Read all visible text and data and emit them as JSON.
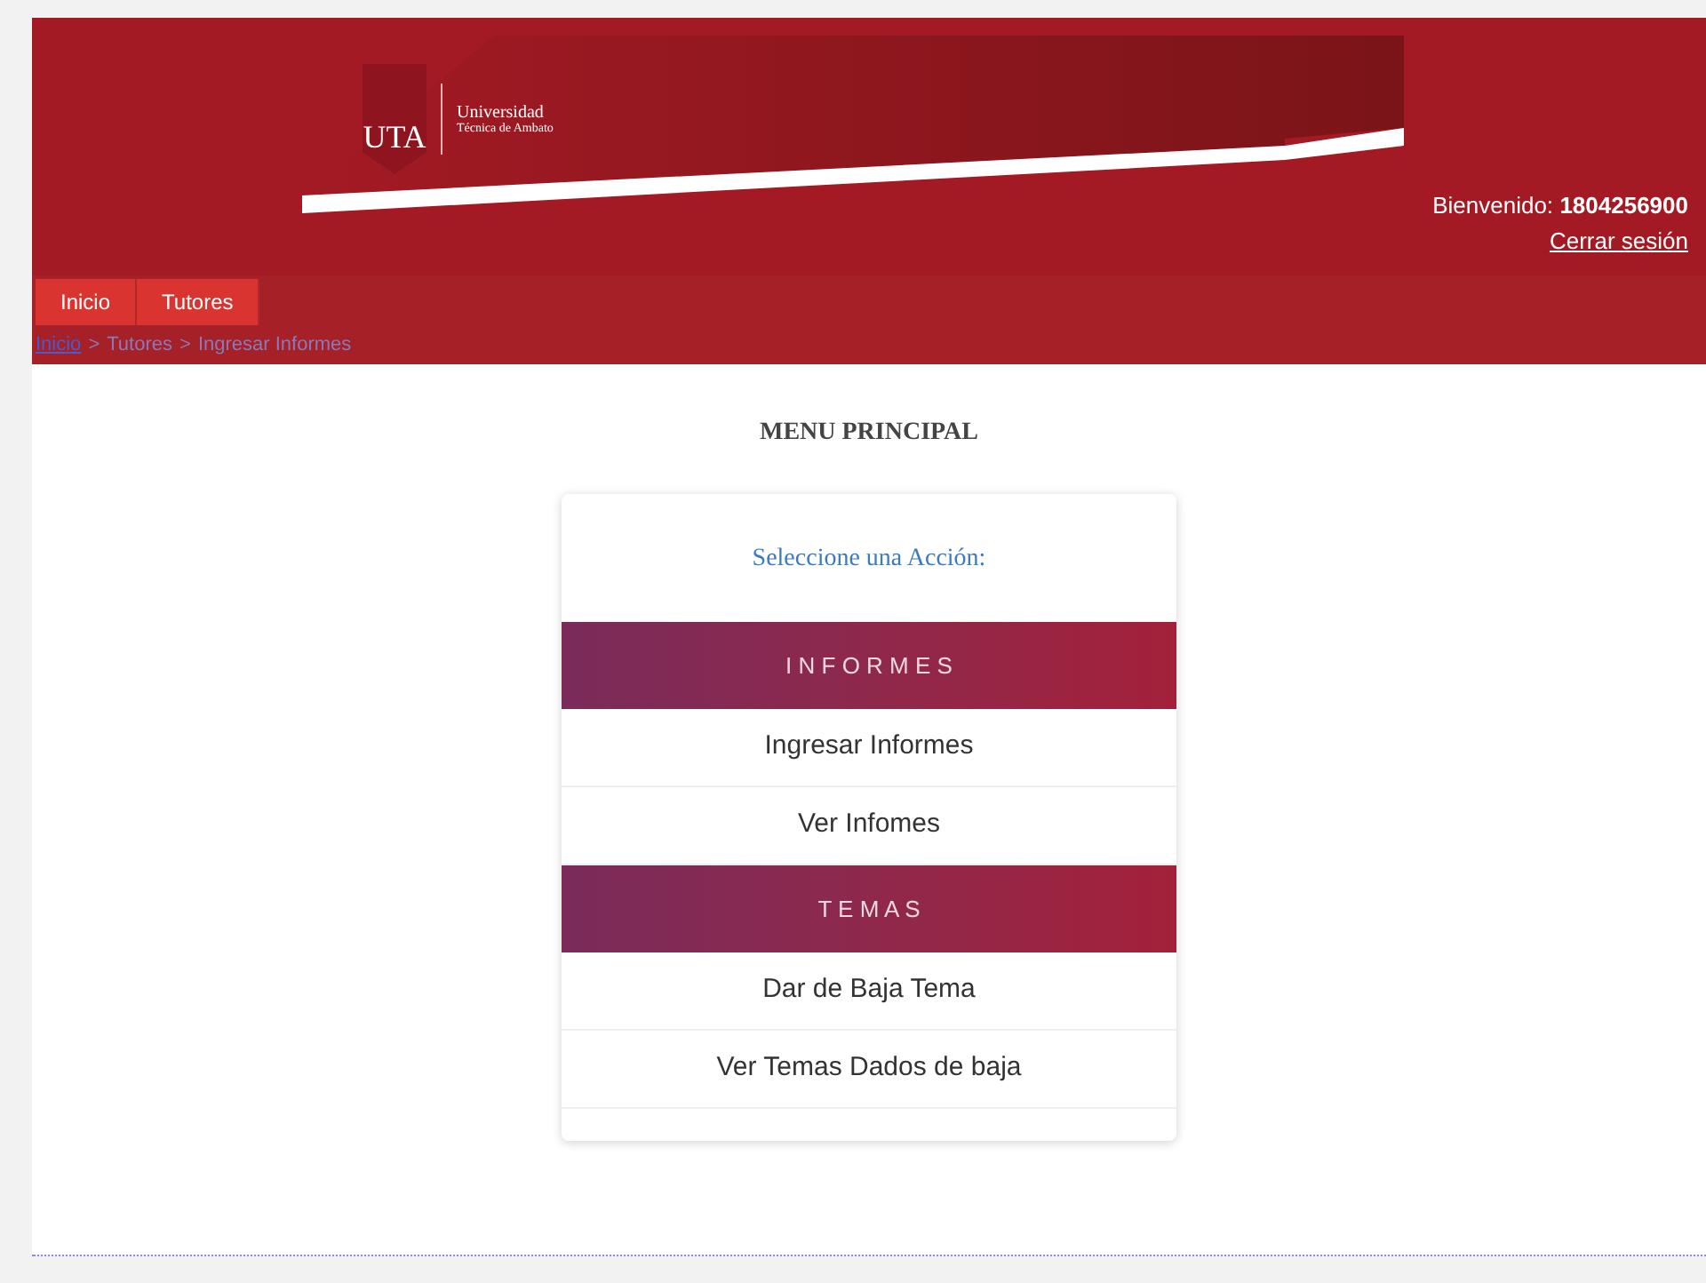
{
  "logo": {
    "mark": "UTA",
    "line1": "Universidad",
    "line2": "Técnica de Ambato"
  },
  "user": {
    "greeting": "Bienvenido:",
    "id": "1804256900",
    "logout": "Cerrar sesión"
  },
  "nav": [
    {
      "label": "Inicio"
    },
    {
      "label": "Tutores"
    }
  ],
  "breadcrumb": [
    {
      "label": "Inicio",
      "kind": "link"
    },
    {
      "label": ">",
      "kind": "sep"
    },
    {
      "label": "Tutores",
      "kind": "text"
    },
    {
      "label": ">",
      "kind": "sep"
    },
    {
      "label": "Ingresar Informes",
      "kind": "text"
    }
  ],
  "title": "MENU PRINCIPAL",
  "menu": {
    "prompt": "Seleccione una Acción:",
    "sections": [
      {
        "heading": "I N F O R M E S",
        "items": [
          "Ingresar Informes",
          "Ver Infomes"
        ]
      },
      {
        "heading": "T E M A S",
        "items": [
          "Dar de Baja Tema",
          "Ver Temas Dados de baja"
        ]
      }
    ]
  }
}
